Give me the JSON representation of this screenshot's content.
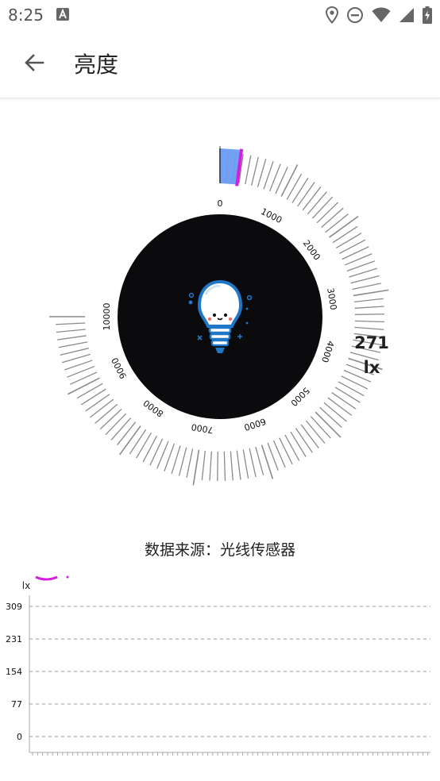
{
  "status_bar": {
    "time": "8:25",
    "icons": [
      "a-notification-icon",
      "location-icon",
      "do-not-disturb-icon",
      "wifi-icon",
      "signal-icon",
      "battery-charging-icon"
    ]
  },
  "app_bar": {
    "back_icon": "arrow-left-icon",
    "title": "亮度"
  },
  "gauge": {
    "min": 0,
    "max": 10000,
    "tick_labels": [
      "0",
      "1000",
      "2000",
      "3000",
      "4000",
      "5000",
      "6000",
      "7000",
      "8000",
      "9000",
      "10000"
    ],
    "current_value": 271,
    "center_icon": "lightbulb-icon",
    "colors": {
      "face": "#0b0b0d",
      "ticks": "#8a8a8a",
      "needle": "#d61ee0",
      "pointer": "#6a9cf2"
    }
  },
  "reading": {
    "value": "271",
    "unit": "lx"
  },
  "data_source_text": "数据来源：光线传感器",
  "chart_data": {
    "type": "line",
    "ylabel": "lx",
    "y_ticks": [
      "309",
      "231",
      "154",
      "77",
      "0"
    ],
    "ylim": [
      0,
      309
    ],
    "grid": true,
    "series": [
      {
        "values": []
      }
    ]
  }
}
